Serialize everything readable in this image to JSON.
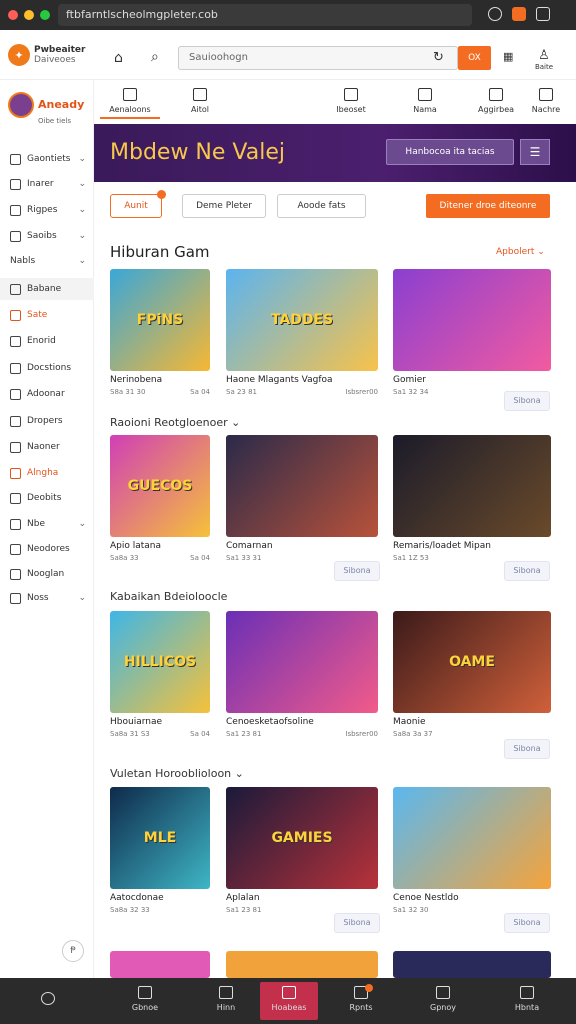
{
  "browser": {
    "url": "ftbfarntlscheolmgpleter.cob",
    "buttons": [
      "share-icon",
      "extension-icon",
      "menu-icon"
    ]
  },
  "brand": {
    "name": "Pwbeaiter",
    "sub": "Daiveoes"
  },
  "header": {
    "search_placeholder": "Sauioohogn",
    "search_button": "OX",
    "right_icon_label": "Baite"
  },
  "profile": {
    "name": "Aneady",
    "sub": "Oibe tiels"
  },
  "sidebar": {
    "items": [
      {
        "label": "Gaontiets",
        "chev": true
      },
      {
        "label": "Inarer",
        "chev": true
      },
      {
        "label": "Rigpes",
        "chev": true
      },
      {
        "label": "Saoibs",
        "chev": true
      },
      {
        "label": "Nabls",
        "chev": true
      },
      {
        "label": "Babane",
        "chev": false
      },
      {
        "label": "Sate",
        "chev": false
      },
      {
        "label": "Enorid",
        "chev": false
      },
      {
        "label": "Docstions",
        "chev": false
      },
      {
        "label": "Adoonar",
        "chev": false
      },
      {
        "label": "Dropers",
        "chev": false
      },
      {
        "label": "Naoner",
        "chev": false
      },
      {
        "label": "Alngha",
        "chev": false
      },
      {
        "label": "Deobits",
        "chev": false
      },
      {
        "label": "Nbe",
        "chev": true
      },
      {
        "label": "Neodores",
        "chev": false
      },
      {
        "label": "Nooglan",
        "chev": false
      },
      {
        "label": "Noss",
        "chev": true
      }
    ]
  },
  "nav": {
    "tabs": [
      "Aenaloons",
      "Aitol",
      "Ibeoset",
      "Nama",
      "Aggirbea",
      "Nachre"
    ]
  },
  "hero": {
    "title": "Mbdew Ne Valej",
    "button": "Hanbocoa ita tacias"
  },
  "filters": {
    "items": [
      "Aunit",
      "Deme Pleter",
      "Aoode fats"
    ],
    "cta": "Ditener droe diteonre"
  },
  "section1": {
    "title": "Hiburan Gam",
    "link": "Apbolert"
  },
  "section2": {
    "subtitle": "Raoioni Reotgloenoer"
  },
  "section3": {
    "subtitle": "Kabaikan Bdeioloocle"
  },
  "section4": {
    "subtitle": "Vuletan Horooblioloon"
  },
  "cards": [
    {
      "title": "Nerinobena",
      "meta": "S8a 31 30",
      "meta2": "Sa 04"
    },
    {
      "title": "Haone Mlagants Vagfoa",
      "meta": "Sa 23 81",
      "meta2": "Isbsrer00"
    },
    {
      "title": "Gomier",
      "meta": "Sa1 32 34",
      "meta2": ""
    },
    {
      "title": "Apio latana",
      "meta": "Sa8a 33",
      "meta2": "Sa 04"
    },
    {
      "title": "Comarnan",
      "meta": "Sa1 33 31",
      "meta2": ""
    },
    {
      "title": "Remaris/loadet Mipan",
      "meta": "Sa1 1Z 53",
      "meta2": ""
    },
    {
      "title": "Hbouiarnae",
      "meta": "Sa8a 31 S3",
      "meta2": "Sa 04"
    },
    {
      "title": "Cenoesketaofsoline",
      "meta": "Sa1 23 81",
      "meta2": "Isbsrer00"
    },
    {
      "title": "Maonie",
      "meta": "Sa8a 3a 37",
      "meta2": ""
    },
    {
      "title": "Aatocdonae",
      "meta": "Sa8a 32 33",
      "meta2": ""
    },
    {
      "title": "Aplalan",
      "meta": "Sa1 23 81",
      "meta2": ""
    },
    {
      "title": "Cenoe Nestldo",
      "meta": "Sa1 32 30",
      "meta2": ""
    }
  ],
  "card_action": "Sibona",
  "thumb_text": [
    "FPiNS",
    "TADDES",
    "",
    "GUECOS",
    "",
    "",
    "HILLICOS",
    "",
    "OAME",
    "MLE",
    "GAMIES",
    ""
  ],
  "bottom": {
    "items": [
      "",
      "Gbnoe",
      "Hinn",
      "Hoabeas",
      "Rpnts",
      "Gpnoy",
      "Hbnta"
    ]
  },
  "scroll_label": "Ᵽ"
}
